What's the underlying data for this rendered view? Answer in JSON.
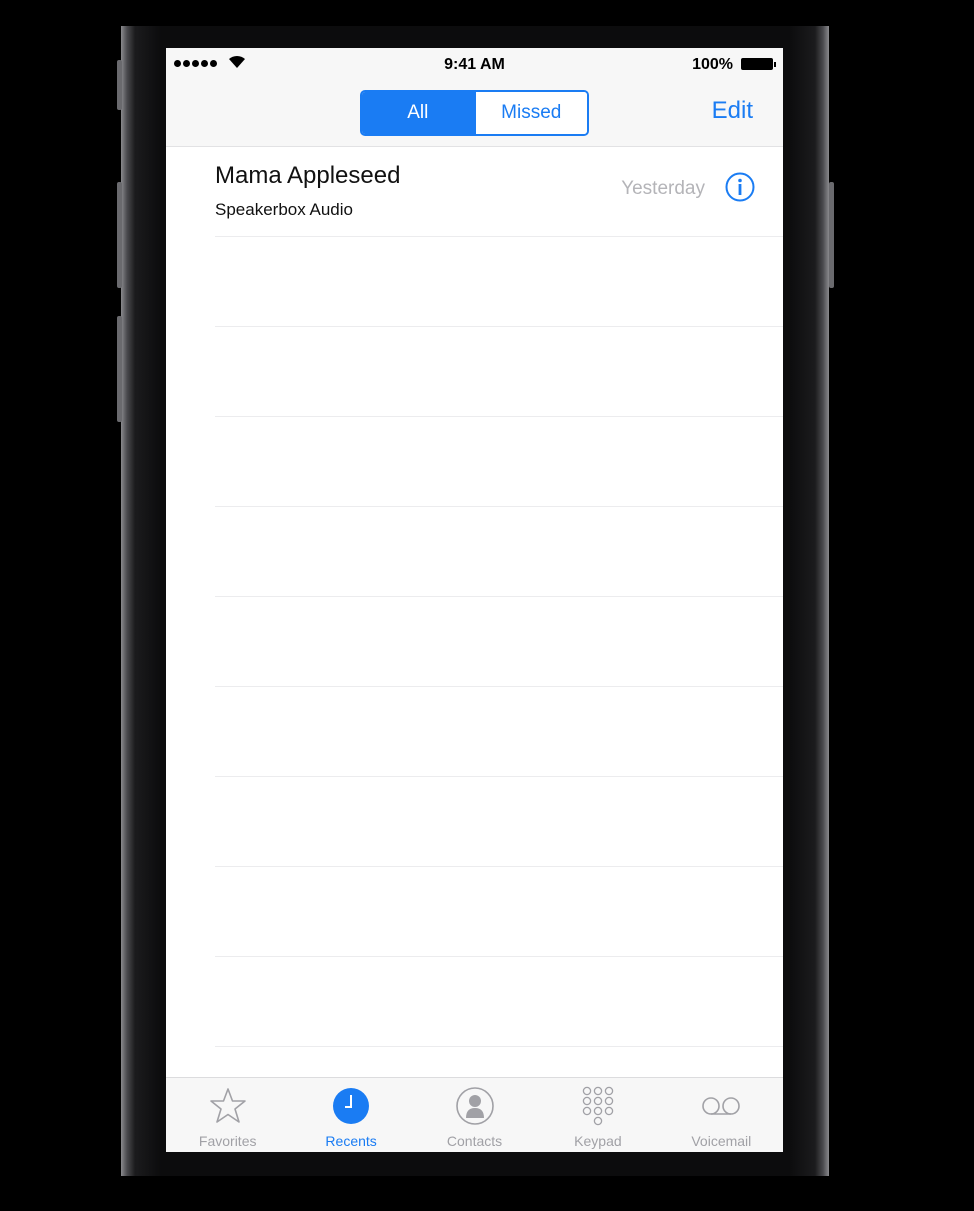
{
  "status_bar": {
    "time": "9:41 AM",
    "battery": "100%"
  },
  "nav": {
    "segments": [
      "All",
      "Missed"
    ],
    "selected_segment": "All",
    "edit_label": "Edit"
  },
  "recents": [
    {
      "name": "Mama Appleseed",
      "subtitle": "Speakerbox Audio",
      "date": "Yesterday"
    }
  ],
  "tabs": [
    {
      "label": "Favorites",
      "icon": "star-icon"
    },
    {
      "label": "Recents",
      "icon": "clock-icon",
      "active": true
    },
    {
      "label": "Contacts",
      "icon": "person-icon"
    },
    {
      "label": "Keypad",
      "icon": "keypad-icon"
    },
    {
      "label": "Voicemail",
      "icon": "voicemail-icon"
    }
  ],
  "colors": {
    "accent": "#1a7cf3",
    "secondary_text": "#b4b4b8",
    "tab_inactive": "#a1a1a6"
  }
}
